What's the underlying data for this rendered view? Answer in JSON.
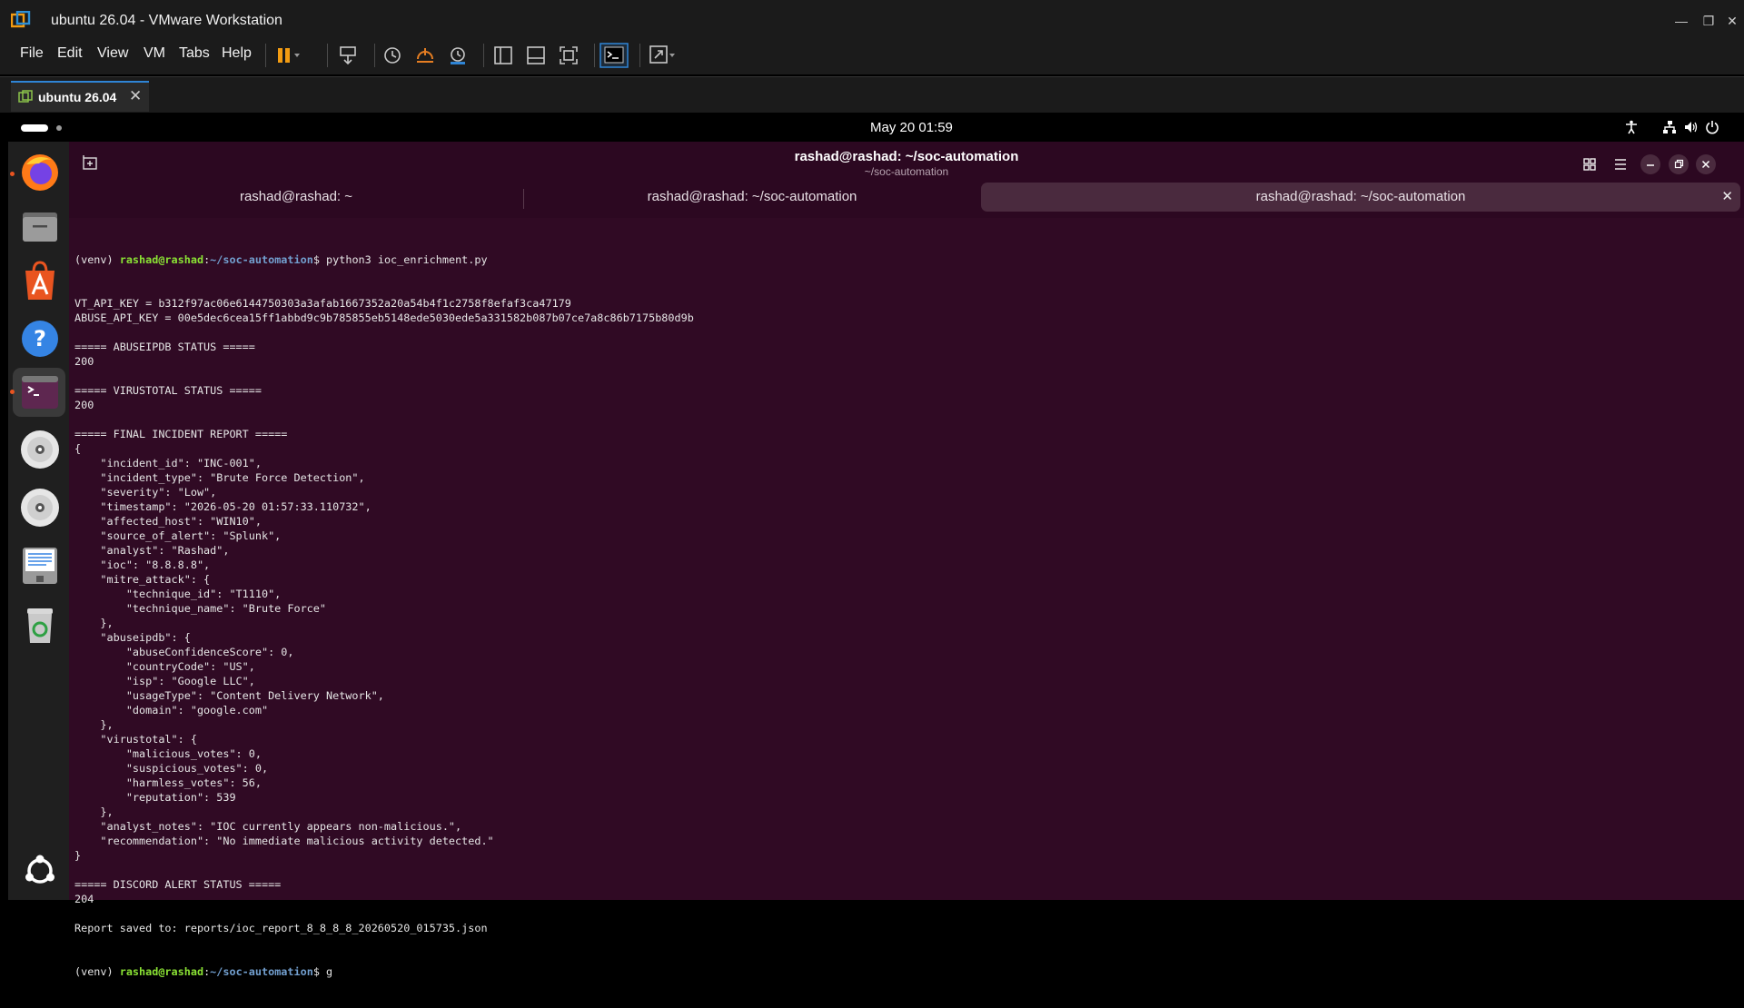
{
  "window": {
    "title": "ubuntu 26.04 - VMware Workstation",
    "app_icon": "vmware-icon"
  },
  "menubar": {
    "items": [
      "File",
      "Edit",
      "View",
      "VM",
      "Tabs",
      "Help"
    ]
  },
  "vm_tab": {
    "label": "ubuntu 26.04"
  },
  "gnome_bar": {
    "clock": "May 20  01:59"
  },
  "terminal": {
    "title": "rashad@rashad: ~/soc-automation",
    "subtitle": "~/soc-automation",
    "tabs": [
      "rashad@rashad: ~",
      "rashad@rashad: ~/soc-automation",
      "rashad@rashad: ~/soc-automation"
    ],
    "prompt": {
      "venv": "(venv) ",
      "user": "rashad@rashad",
      "colon": ":",
      "path": "~/soc-automation",
      "dollar": "$ "
    },
    "command_first": "python3 ioc_enrichment.py",
    "command_last": "g",
    "lines": [
      "VT_API_KEY = b312f97ac06e6144750303a3afab1667352a20a54b4f1c2758f8efaf3ca47179",
      "ABUSE_API_KEY = 00e5dec6cea15ff1abbd9c9b785855eb5148ede5030ede5a331582b087b07ce7a8c86b7175b80d9b",
      "",
      "===== ABUSEIPDB STATUS =====",
      "200",
      "",
      "===== VIRUSTOTAL STATUS =====",
      "200",
      "",
      "===== FINAL INCIDENT REPORT =====",
      "{",
      "    \"incident_id\": \"INC-001\",",
      "    \"incident_type\": \"Brute Force Detection\",",
      "    \"severity\": \"Low\",",
      "    \"timestamp\": \"2026-05-20 01:57:33.110732\",",
      "    \"affected_host\": \"WIN10\",",
      "    \"source_of_alert\": \"Splunk\",",
      "    \"analyst\": \"Rashad\",",
      "    \"ioc\": \"8.8.8.8\",",
      "    \"mitre_attack\": {",
      "        \"technique_id\": \"T1110\",",
      "        \"technique_name\": \"Brute Force\"",
      "    },",
      "    \"abuseipdb\": {",
      "        \"abuseConfidenceScore\": 0,",
      "        \"countryCode\": \"US\",",
      "        \"isp\": \"Google LLC\",",
      "        \"usageType\": \"Content Delivery Network\",",
      "        \"domain\": \"google.com\"",
      "    },",
      "    \"virustotal\": {",
      "        \"malicious_votes\": 0,",
      "        \"suspicious_votes\": 0,",
      "        \"harmless_votes\": 56,",
      "        \"reputation\": 539",
      "    },",
      "    \"analyst_notes\": \"IOC currently appears non-malicious.\",",
      "    \"recommendation\": \"No immediate malicious activity detected.\"",
      "}",
      "",
      "===== DISCORD ALERT STATUS =====",
      "204",
      "",
      "Report saved to: reports/ioc_report_8_8_8_8_20260520_015735.json"
    ]
  },
  "colors": {
    "terminal_bg": "#300a24",
    "prompt_user": "#8ae234",
    "prompt_path": "#729fcf",
    "accent": "#e95420"
  }
}
